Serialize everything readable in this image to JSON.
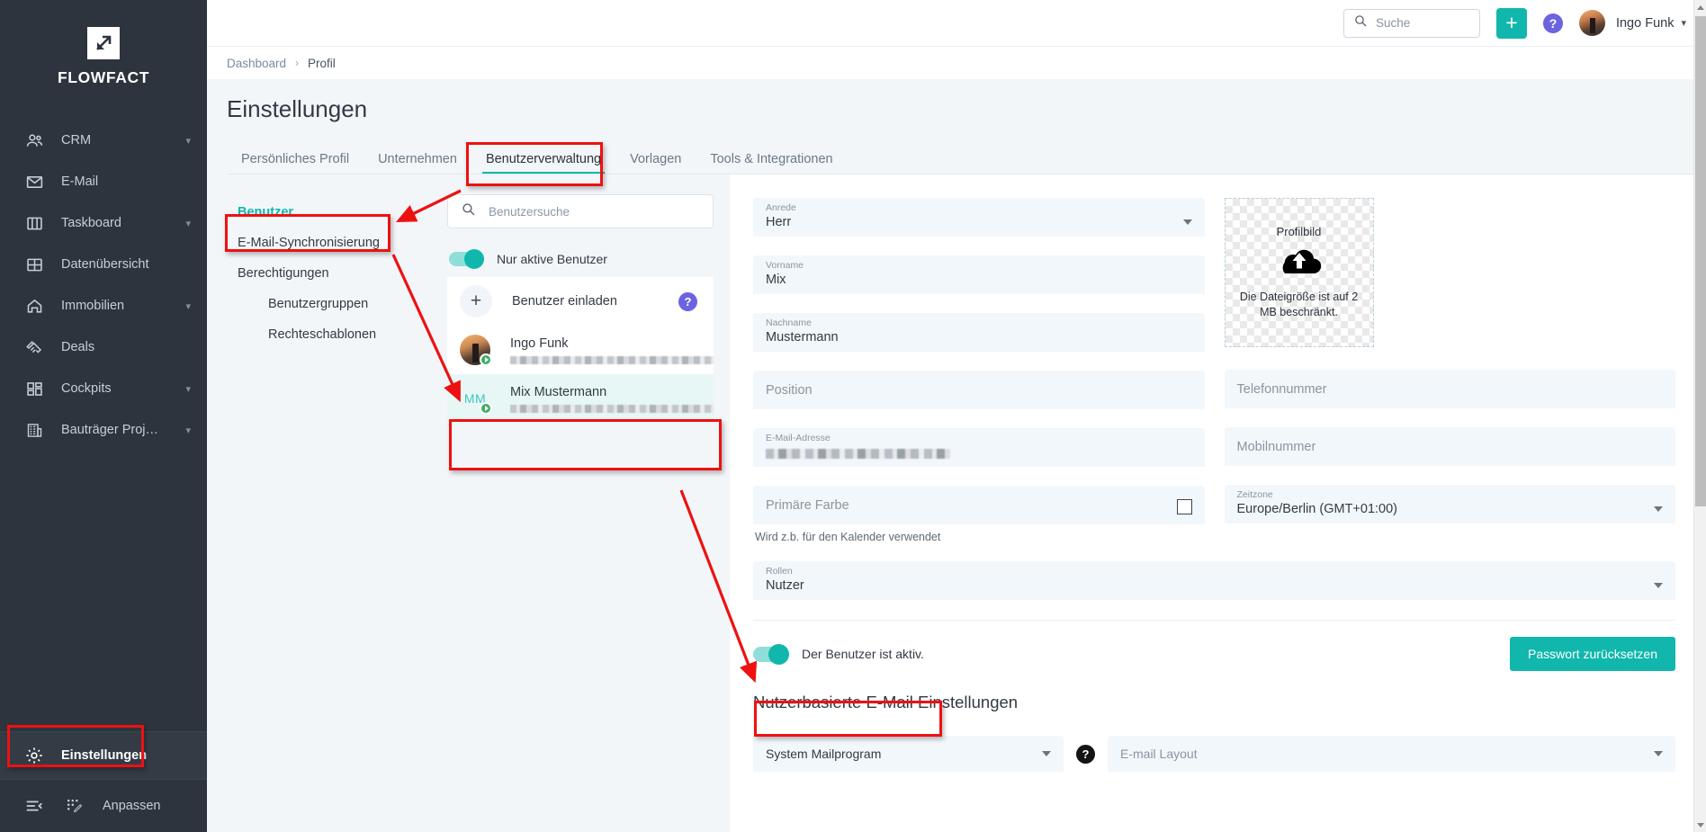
{
  "brand": {
    "name": "FLOWFACT",
    "logo_icon": "arrow-up-right-logo-icon"
  },
  "sidebar": {
    "items": [
      {
        "label": "CRM",
        "icon": "people-icon",
        "expandable": true
      },
      {
        "label": "E-Mail",
        "icon": "envelope-icon",
        "expandable": false
      },
      {
        "label": "Taskboard",
        "icon": "columns-icon",
        "expandable": true
      },
      {
        "label": "Datenübersicht",
        "icon": "grid-icon",
        "expandable": false
      },
      {
        "label": "Immobilien",
        "icon": "home-icon",
        "expandable": true
      },
      {
        "label": "Deals",
        "icon": "handshake-icon",
        "expandable": false
      },
      {
        "label": "Cockpits",
        "icon": "dashboard-icon",
        "expandable": true
      },
      {
        "label": "Bauträger Proj…",
        "icon": "building-icon",
        "expandable": true
      }
    ],
    "settings_label": "Einstellungen",
    "settings_icon": "gear-icon",
    "collapse_icon": "collapse-menu-icon",
    "customize_label": "Anpassen",
    "customize_icon": "customize-icon"
  },
  "topbar": {
    "search_placeholder": "Suche",
    "search_icon": "search-icon",
    "add_label": "+",
    "help_label": "?",
    "user_name": "Ingo Funk",
    "chevron": "⌄"
  },
  "breadcrumb": {
    "root": "Dashboard",
    "separator": "›",
    "current": "Profil"
  },
  "page": {
    "title": "Einstellungen"
  },
  "tabs": [
    {
      "label": "Persönliches Profil",
      "active": false
    },
    {
      "label": "Unternehmen",
      "active": false
    },
    {
      "label": "Benutzerverwaltung",
      "active": true
    },
    {
      "label": "Vorlagen",
      "active": false
    },
    {
      "label": "Tools & Integrationen",
      "active": false
    }
  ],
  "subnav": [
    {
      "label": "Benutzer",
      "active": true,
      "indent": false
    },
    {
      "label": "E-Mail-Synchronisierung",
      "active": false,
      "indent": false
    },
    {
      "label": "Berechtigungen",
      "active": false,
      "indent": false
    },
    {
      "label": "Benutzergruppen",
      "active": false,
      "indent": true
    },
    {
      "label": "Rechteschablonen",
      "active": false,
      "indent": true
    }
  ],
  "userpanel": {
    "search_placeholder": "Benutzersuche",
    "search_icon": "search-icon",
    "only_active_label": "Nur aktive Benutzer",
    "only_active_on": true,
    "invite_label": "Benutzer einladen",
    "invite_icon": "plus-icon",
    "invite_help_label": "?",
    "users": [
      {
        "name": "Ingo Funk",
        "email_redacted": true,
        "selected": false,
        "avatar_type": "photo"
      },
      {
        "name": "Mix Mustermann",
        "email_redacted": true,
        "selected": true,
        "avatar_type": "initials",
        "initials": "MM"
      }
    ]
  },
  "form": {
    "anrede": {
      "label": "Anrede",
      "value": "Herr"
    },
    "vorname": {
      "label": "Vorname",
      "value": "Mix"
    },
    "nachname": {
      "label": "Nachname",
      "value": "Mustermann"
    },
    "position": {
      "placeholder": "Position",
      "value": ""
    },
    "email": {
      "label": "E-Mail-Adresse",
      "value_redacted": true
    },
    "primaerfarbe": {
      "placeholder": "Primäre Farbe",
      "hint": "Wird z.b. für den Kalender verwendet"
    },
    "profilbild": {
      "title": "Profilbild",
      "note": "Die Dateigröße ist auf 2 MB beschränkt.",
      "icon": "cloud-upload-icon"
    },
    "telefonnummer": {
      "placeholder": "Telefonnummer",
      "value": ""
    },
    "mobilnummer": {
      "placeholder": "Mobilnummer",
      "value": ""
    },
    "zeitzone": {
      "label": "Zeitzone",
      "value": "Europe/Berlin (GMT+01:00)"
    },
    "rollen": {
      "label": "Rollen",
      "value": "Nutzer"
    }
  },
  "bottom": {
    "user_active_label": "Der Benutzer ist aktiv.",
    "user_active_on": true,
    "reset_password_label": "Passwort zurücksetzen",
    "section_title": "Nutzerbasierte E-Mail Einstellungen",
    "mail_program": "System Mailprogram",
    "mail_help_label": "?",
    "mail_layout_placeholder": "E-mail Layout"
  },
  "colors": {
    "accent": "#11b7ac",
    "sidebar_bg": "#2d343d",
    "page_bg": "#f2f6f9",
    "field_bg": "#f2f7fb",
    "annotation_red": "#ee1111",
    "help_purple": "#6c63e0",
    "status_green": "#3fae63"
  }
}
